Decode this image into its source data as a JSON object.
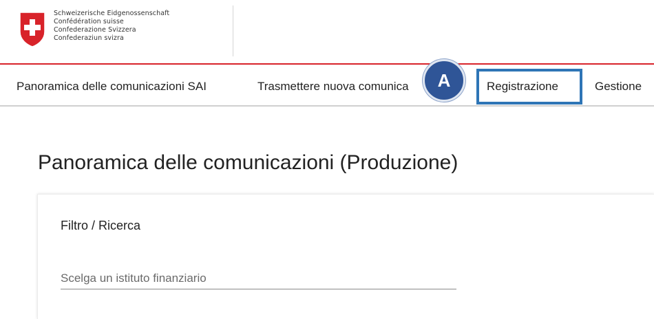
{
  "header": {
    "logo_icon": "swiss-cross-shield-icon",
    "logo_lines": [
      "Schweizerische Eidgenossenschaft",
      "Confédération suisse",
      "Confederazione Svizzera",
      "Confederaziun svizra"
    ]
  },
  "nav": {
    "items": [
      {
        "label": "Panoramica delle comunicazioni SAI"
      },
      {
        "label": "Trasmettere nuova comunica"
      },
      {
        "label": "Registrazione"
      },
      {
        "label": "Gestione"
      }
    ],
    "annotation_badge": "A",
    "colors": {
      "accent_red": "#d8232a",
      "highlight_blue": "#2e75b6",
      "badge_blue": "#2f5597"
    }
  },
  "main": {
    "title": "Panoramica delle comunicazioni (Produzione)",
    "filter": {
      "title": "Filtro / Ricerca",
      "institution_placeholder": "Scelga un istituto finanziario"
    }
  }
}
